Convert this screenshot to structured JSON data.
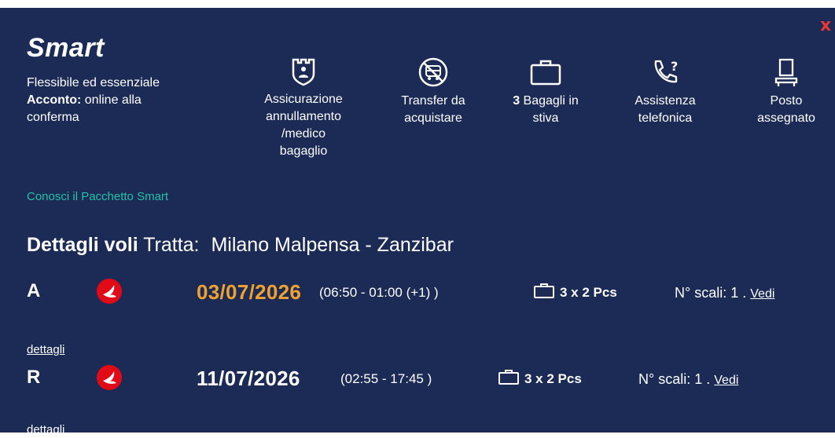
{
  "colors": {
    "panel_bg": "#1c2b55",
    "accent_teal": "#25c2a6",
    "date_orange": "#f0a230",
    "close_red": "#e53935",
    "airline_red": "#e30a17"
  },
  "package": {
    "name": "Smart",
    "tagline": "Flessibile ed essenziale",
    "deposit_label": "Acconto:",
    "deposit_line1": " online alla",
    "deposit_line2": "conferma",
    "link_label": "Conosci il Pacchetto Smart"
  },
  "features": [
    {
      "icon": "insurance-shield-icon",
      "lines": [
        "Assicurazione",
        "annullamento",
        "/medico",
        "bagaglio"
      ]
    },
    {
      "icon": "no-transfer-bus-icon",
      "lines": [
        "Transfer da",
        "acquistare"
      ]
    },
    {
      "icon": "suitcase-icon",
      "count": "3",
      "lines": [
        " Bagagli in",
        "stiva"
      ]
    },
    {
      "icon": "phone-help-icon",
      "lines": [
        "Assistenza",
        "telefonica"
      ]
    },
    {
      "icon": "seat-icon",
      "lines": [
        "Posto",
        "assegnato"
      ]
    }
  ],
  "flights_section": {
    "title": "Dettagli voli",
    "route_label": "Tratta:",
    "route": "Milano Malpensa - Zanzibar"
  },
  "flights": [
    {
      "direction": "A",
      "date": "03/07/2026",
      "times": "(06:50 - 01:00 (+1) )",
      "baggage": "3 x 2 Pcs",
      "stops": "N° scali: 1 .",
      "details_a": "Vedi",
      "details_b": "dettagli"
    },
    {
      "direction": "R",
      "date": "11/07/2026",
      "times": "(02:55 - 17:45 )",
      "baggage": "3 x 2 Pcs",
      "stops": "N° scali: 1 .",
      "details_a": "Vedi",
      "details_b": "dettagli"
    }
  ],
  "close_label": "x"
}
